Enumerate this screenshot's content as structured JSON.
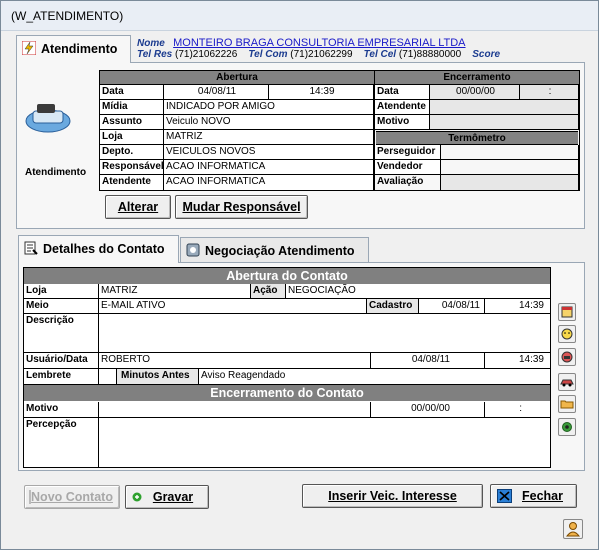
{
  "window": {
    "title": "(W_ATENDIMENTO)"
  },
  "top_tab": {
    "label": "Atendimento"
  },
  "client": {
    "name_label": "Nome",
    "name_value": "MONTEIRO BRAGA CONSULTORIA EMPRESARIAL LTDA",
    "tel_res_label": "Tel Res",
    "tel_res": "(71)21062226",
    "tel_com_label": "Tel Com",
    "tel_com": "(71)21062299",
    "tel_cel_label": "Tel Cel",
    "tel_cel": "(71)88880000",
    "score_label": "Score"
  },
  "icon_caption": "Atendimento",
  "abertura": {
    "header": "Abertura",
    "data_label": "Data",
    "data": "04/08/11",
    "hora": "14:39",
    "midia_label": "Mídia",
    "midia": "INDICADO POR AMIGO",
    "assunto_label": "Assunto",
    "assunto": "Veiculo NOVO",
    "loja_label": "Loja",
    "loja": "MATRIZ",
    "depto_label": "Depto.",
    "depto": "VEICULOS NOVOS",
    "responsavel_label": "Responsável",
    "responsavel": "ACAO INFORMATICA",
    "atendente_label": "Atendente",
    "atendente": "ACAO INFORMATICA"
  },
  "encerramento": {
    "header": "Encerramento",
    "data_label": "Data",
    "data": "00/00/00",
    "hora": ":",
    "atendente_label": "Atendente",
    "motivo_label": "Motivo",
    "termometro_header": "Termômetro",
    "perseguidor_label": "Perseguidor",
    "vendedor_label": "Vendedor",
    "avaliacao_label": "Avaliação"
  },
  "buttons_top": {
    "alterar": "Alterar",
    "mudar": "Mudar Responsável"
  },
  "tabs": [
    {
      "label": "Detalhes do Contato"
    },
    {
      "label": "Negociação Atendimento"
    }
  ],
  "contato": {
    "abertura_header": "Abertura do Contato",
    "loja_label": "Loja",
    "loja": "MATRIZ",
    "acao_label": "Ação",
    "acao": "NEGOCIAÇÃO",
    "meio_label": "Meio",
    "meio": "E-MAIL ATIVO",
    "cadastro_label": "Cadastro",
    "cadastro_data": "04/08/11",
    "cadastro_hora": "14:39",
    "descricao_label": "Descrição",
    "usuario_label": "Usuário/Data",
    "usuario": "ROBERTO",
    "usuario_data": "04/08/11",
    "usuario_hora": "14:39",
    "lembrete_label": "Lembrete",
    "minutos_label": "Minutos Antes",
    "aviso": "Aviso Reagendado",
    "encerramento_header": "Encerramento do Contato",
    "motivo_label": "Motivo",
    "motivo_data": "00/00/00",
    "motivo_hora": ":",
    "percepcao_label": "Percepção"
  },
  "buttons_bottom": {
    "novo": "Novo Contato",
    "gravar": "Gravar",
    "inserir": "Inserir Veic. Interesse",
    "fechar": "Fechar"
  }
}
